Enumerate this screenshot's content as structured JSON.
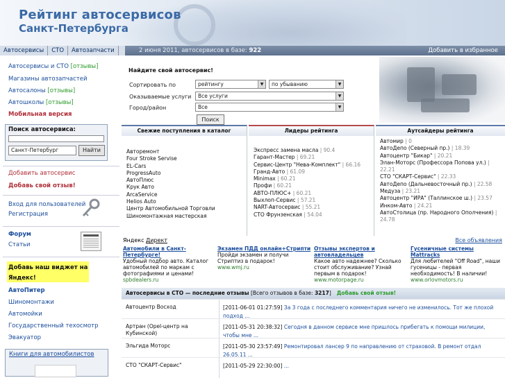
{
  "header": {
    "title": "Рейтинг автосервисов",
    "subtitle": "Санкт-Петербурга"
  },
  "topnav": {
    "tabs": [
      "Автосервисы",
      "СТО",
      "Автозапчасти"
    ],
    "date_text": "2 июня 2011, автосервисов в базе:",
    "count": "922",
    "favorite": "Добавить в избранное"
  },
  "left": {
    "link1": "Автосервисы и СТО",
    "link1_tag": "[отзывы]",
    "link2": "Магазины автозапчастей",
    "link3": "Автосалоны",
    "link3_tag": "[отзывы]",
    "link4": "Автошколы",
    "link4_tag": "[отзывы]",
    "mobile": "Мобильная версия",
    "search_title": "Поиск автосервиса:",
    "city": "Санкт-Петербург",
    "find_button": "Найти",
    "add_service": "Добавить автосервис",
    "add_review": "Добавь свой отзыв!",
    "login": "Вход для пользователей",
    "register": "Регистрация",
    "forum": "Форум",
    "articles": "Статьи",
    "widget": "Добавь наш виджет на Яндекс!",
    "autopiter": "АвтоПитер",
    "tires": "Шиномонтажи",
    "cars": "Автомойки",
    "techinspection": "Государственный техосмотр",
    "tow": "Эвакуатор",
    "books": "Книги для автомобилистов"
  },
  "finder": {
    "heading": "Найдите свой автосервис!",
    "sort_label": "Сортировать по",
    "sort_value": "рейтингу",
    "order_value": "по убыванию",
    "services_label": "Оказываемые услуги",
    "services_value": "Все услуги",
    "city_label": "Город/район",
    "city_value": "Все",
    "search_button": "Поиск"
  },
  "columns": {
    "new_title": "Свежие поступления в каталог",
    "new_items": [
      "Авторемонт",
      "Four Stroke Servise",
      "EL-Cars",
      "ProgressAuto",
      "АвтоПлюс",
      "Крук Авто",
      "ArcaService",
      "Helios Auto",
      "Центр Автомобильной Торговли",
      "Шиномонтажная мастерская"
    ],
    "leaders_title": "Лидеры рейтинга",
    "leaders": [
      {
        "name": "Экспресс замена масла",
        "score": "90.4"
      },
      {
        "name": "Гарант-Мастер",
        "score": "69.21"
      },
      {
        "name": "Сервис-Центр \"Нева-Комплект\"",
        "score": "66.16"
      },
      {
        "name": "Гранд-Авто",
        "score": "61.09"
      },
      {
        "name": "Minimax",
        "score": "60.21"
      },
      {
        "name": "Профи",
        "score": "60.21"
      },
      {
        "name": "АВТО-ПЛЮС+",
        "score": "60.21"
      },
      {
        "name": "Выхлоп-Сервис",
        "score": "57.21"
      },
      {
        "name": "NART-Автосервис",
        "score": "55.21"
      },
      {
        "name": "СТО Фрунзенская",
        "score": "54.04"
      }
    ],
    "outsiders_title": "Аутсайдеры рейтинга",
    "outsiders": [
      {
        "name": "Автомир",
        "score": "0"
      },
      {
        "name": "АвтоДепо (Северный пр.)",
        "score": "18.39"
      },
      {
        "name": "Автоцентр \"Бикар\"",
        "score": "20.21"
      },
      {
        "name": "Элан-Моторс (Профессора Попова ул.)",
        "score": "22.21"
      },
      {
        "name": "СТО \"СКАРТ-Сервис\"",
        "score": "22.33"
      },
      {
        "name": "АвтоДепо (Дальневосточный пр.)",
        "score": "22.58"
      },
      {
        "name": "Медуза",
        "score": "23.21"
      },
      {
        "name": "Автоцентр \"ИРА\" (Таллинское ш.)",
        "score": "23.57"
      },
      {
        "name": "Инком-Авто",
        "score": "24.21"
      },
      {
        "name": "АвтоСтолица (пр. Народного Ополчения)",
        "score": "24.78"
      }
    ]
  },
  "ads": {
    "yandex": "Яндекс",
    "direct": "Директ",
    "all": "Все объявления",
    "items": [
      {
        "title": "Автомобили в Санкт-Петербурге!",
        "desc": "Удобный подбор авто. Каталог автомобилей по маркам с фотографиями и ценами!",
        "url": "spbdealers.ru"
      },
      {
        "title": "Экзамен ПДД онлайн+Стрипти",
        "desc": "Пройди экзамен и получи Стриптиз в подарок!",
        "url": "www.wmj.ru"
      },
      {
        "title": "Отзывы экспертов и автовладельцев",
        "desc": "Какое авто надежнее? Сколько стоит обслуживание? Узнай первым в подарок!",
        "url": "www.motorpage.ru"
      },
      {
        "title": "Гусеничные системы Mattracks",
        "desc": "Для любителей \"Off Road\", наши гусеницы - первая необходимость! В наличии!",
        "url": "www.orlovmotors.ru"
      }
    ]
  },
  "reviews": {
    "heading": "Автосервисы в СТО — последние отзывы",
    "total_label": "[Всего отзывов в базе:",
    "total": "3217",
    "total_close": "]",
    "add": "Добавь свой отзыв!",
    "rows": [
      {
        "name": "Автоцентр Восход",
        "ts": "[2011-06-01 01:27:59]",
        "msg": "За 3 года с последнего комментария ничего не изменилось. Тот же плохой подход ..."
      },
      {
        "name": "Артран (Opel-центр на Кубинской)",
        "ts": "[2011-05-31 20:38:32]",
        "msg": "Сегодня в данном сервисе мне пришлось прибегать к помощи милиции, чтобы мне ..."
      },
      {
        "name": "Эльгида Моторс",
        "ts": "[2011-05-30 23:57:49]",
        "msg": "Ремонтировал лансер 9 по направлению от страховой. В ремонт отдал 26.05.11 ..."
      },
      {
        "name": "СТО \"СКАРТ-Сервис\"",
        "ts": "[2011-05-29 22:30:00]",
        "msg": "..."
      }
    ]
  }
}
